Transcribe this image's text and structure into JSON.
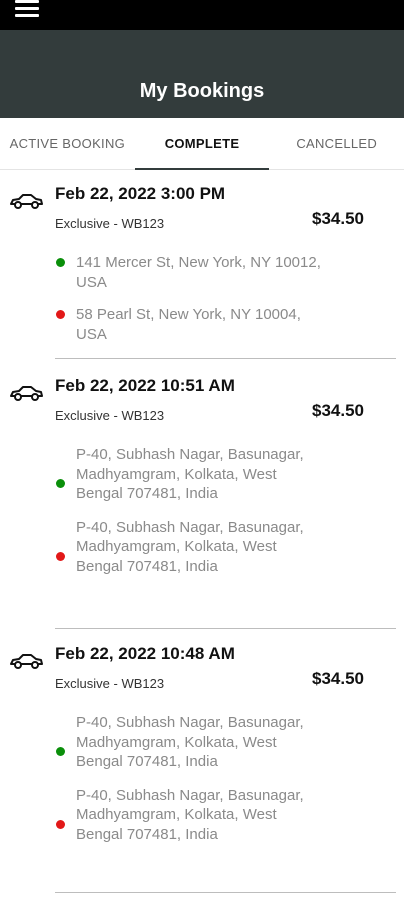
{
  "header": {
    "title": "My Bookings",
    "menu_icon": "hamburger-menu-icon"
  },
  "tabs": [
    {
      "label": "ACTIVE BOOKING",
      "active": false
    },
    {
      "label": "COMPLETE",
      "active": true
    },
    {
      "label": "CANCELLED",
      "active": false
    }
  ],
  "bookings": [
    {
      "datetime": "Feb 22, 2022 3:00 PM",
      "ride": "Exclusive - WB123",
      "price": "$34.50",
      "pickup": "141 Mercer St, New York, NY 10012, USA",
      "dropoff": "58 Pearl St, New York, NY 10004, USA"
    },
    {
      "datetime": "Feb 22, 2022 10:51 AM",
      "ride": "Exclusive - WB123",
      "price": "$34.50",
      "pickup": "P-40, Subhash Nagar, Basunagar, Madhyamgram, Kolkata, West Bengal 707481, India",
      "dropoff": "P-40, Subhash Nagar, Basunagar, Madhyamgram, Kolkata, West Bengal 707481, India"
    },
    {
      "datetime": "Feb 22, 2022 10:48 AM",
      "ride": "Exclusive - WB123",
      "price": "$34.50",
      "pickup": "P-40, Subhash Nagar, Basunagar, Madhyamgram, Kolkata, West Bengal 707481, India",
      "dropoff": "P-40, Subhash Nagar, Basunagar, Madhyamgram, Kolkata, West Bengal 707481, India"
    }
  ],
  "colors": {
    "app_bar": "#333c3c",
    "pickup_dot": "#0a8f0a",
    "dropoff_dot": "#e21818"
  }
}
